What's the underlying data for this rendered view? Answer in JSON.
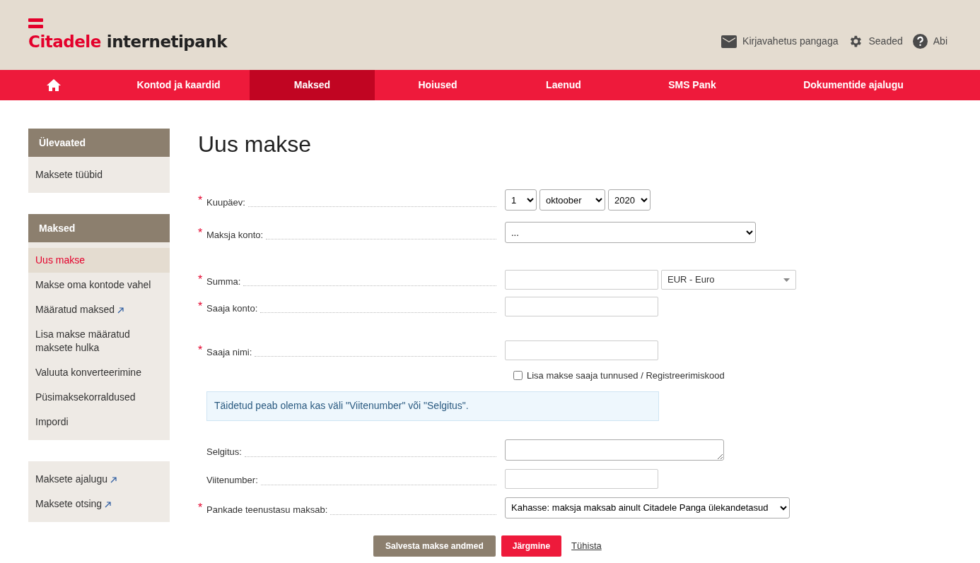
{
  "header": {
    "logo_brand": "Citadele",
    "logo_product": "internetipank",
    "links": [
      {
        "kind": "mail",
        "label": "Kirjavahetus pangaga"
      },
      {
        "kind": "settings",
        "label": "Seaded"
      },
      {
        "kind": "help",
        "label": "Abi"
      }
    ]
  },
  "nav": [
    {
      "kind": "home",
      "selected": false
    },
    {
      "label": "Kontod ja kaardid",
      "selected": false
    },
    {
      "label": "Maksed",
      "selected": true
    },
    {
      "label": "Hoiused",
      "selected": false
    },
    {
      "label": "Laenud",
      "selected": false
    },
    {
      "label": "SMS Pank",
      "selected": false
    },
    {
      "label": "Dokumentide ajalugu",
      "selected": false
    }
  ],
  "sidebar": [
    {
      "title": "Ülevaated",
      "items": [
        {
          "label": "Maksete tüübid",
          "external": false,
          "selected": false
        }
      ]
    },
    {
      "title": "Maksed",
      "items": [
        {
          "label": "Uus makse",
          "external": false,
          "selected": true
        },
        {
          "label": "Makse oma kontode vahel",
          "external": false,
          "selected": false
        },
        {
          "label": "Määratud maksed",
          "external": true,
          "selected": false
        },
        {
          "label": "Lisa makse määratud maksete hulka",
          "external": false,
          "selected": false
        },
        {
          "label": "Valuuta konverteerimine",
          "external": false,
          "selected": false
        },
        {
          "label": "Püsimaksekorraldused",
          "external": false,
          "selected": false
        },
        {
          "label": "Impordi",
          "external": false,
          "selected": false
        }
      ]
    },
    {
      "items": [
        {
          "label": "Maksete ajalugu",
          "external": true,
          "selected": false
        },
        {
          "label": "Maksete otsing",
          "external": true,
          "selected": false
        }
      ]
    }
  ],
  "page_title": "Uus makse",
  "form": [
    {
      "kind": "date",
      "label": "Kuupäev:",
      "required_mark": "*",
      "day": "1",
      "month": "oktoober",
      "year": "2020"
    },
    {
      "kind": "select",
      "label": "Maksja konto:",
      "required_mark": "*",
      "value": "..."
    },
    {
      "kind": "amount",
      "label": "Summa:",
      "required_mark": "*",
      "currency": "EUR - Euro"
    },
    {
      "kind": "input",
      "label": "Saaja konto:",
      "required_mark": "*"
    },
    {
      "kind": "input",
      "label": "Saaja nimi:",
      "required_mark": "*"
    },
    {
      "kind": "checkbox",
      "label": "Lisa makse saaja tunnused / Registreerimiskood",
      "checked": false
    },
    {
      "kind": "info",
      "text": "Täidetud peab olema kas väli \"Viitenumber\" või \"Selgitus\"."
    },
    {
      "kind": "textarea",
      "label": "Selgitus:"
    },
    {
      "kind": "input",
      "label": "Viitenumber:"
    },
    {
      "kind": "fee",
      "label": "Pankade teenustasu maksab:",
      "required_mark": "*",
      "value": "Kahasse: maksja maksab ainult Citadele Panga ülekandetasud"
    }
  ],
  "buttons": {
    "save": "Salvesta makse andmed",
    "next": "Järgmine",
    "cancel": "Tühista"
  }
}
